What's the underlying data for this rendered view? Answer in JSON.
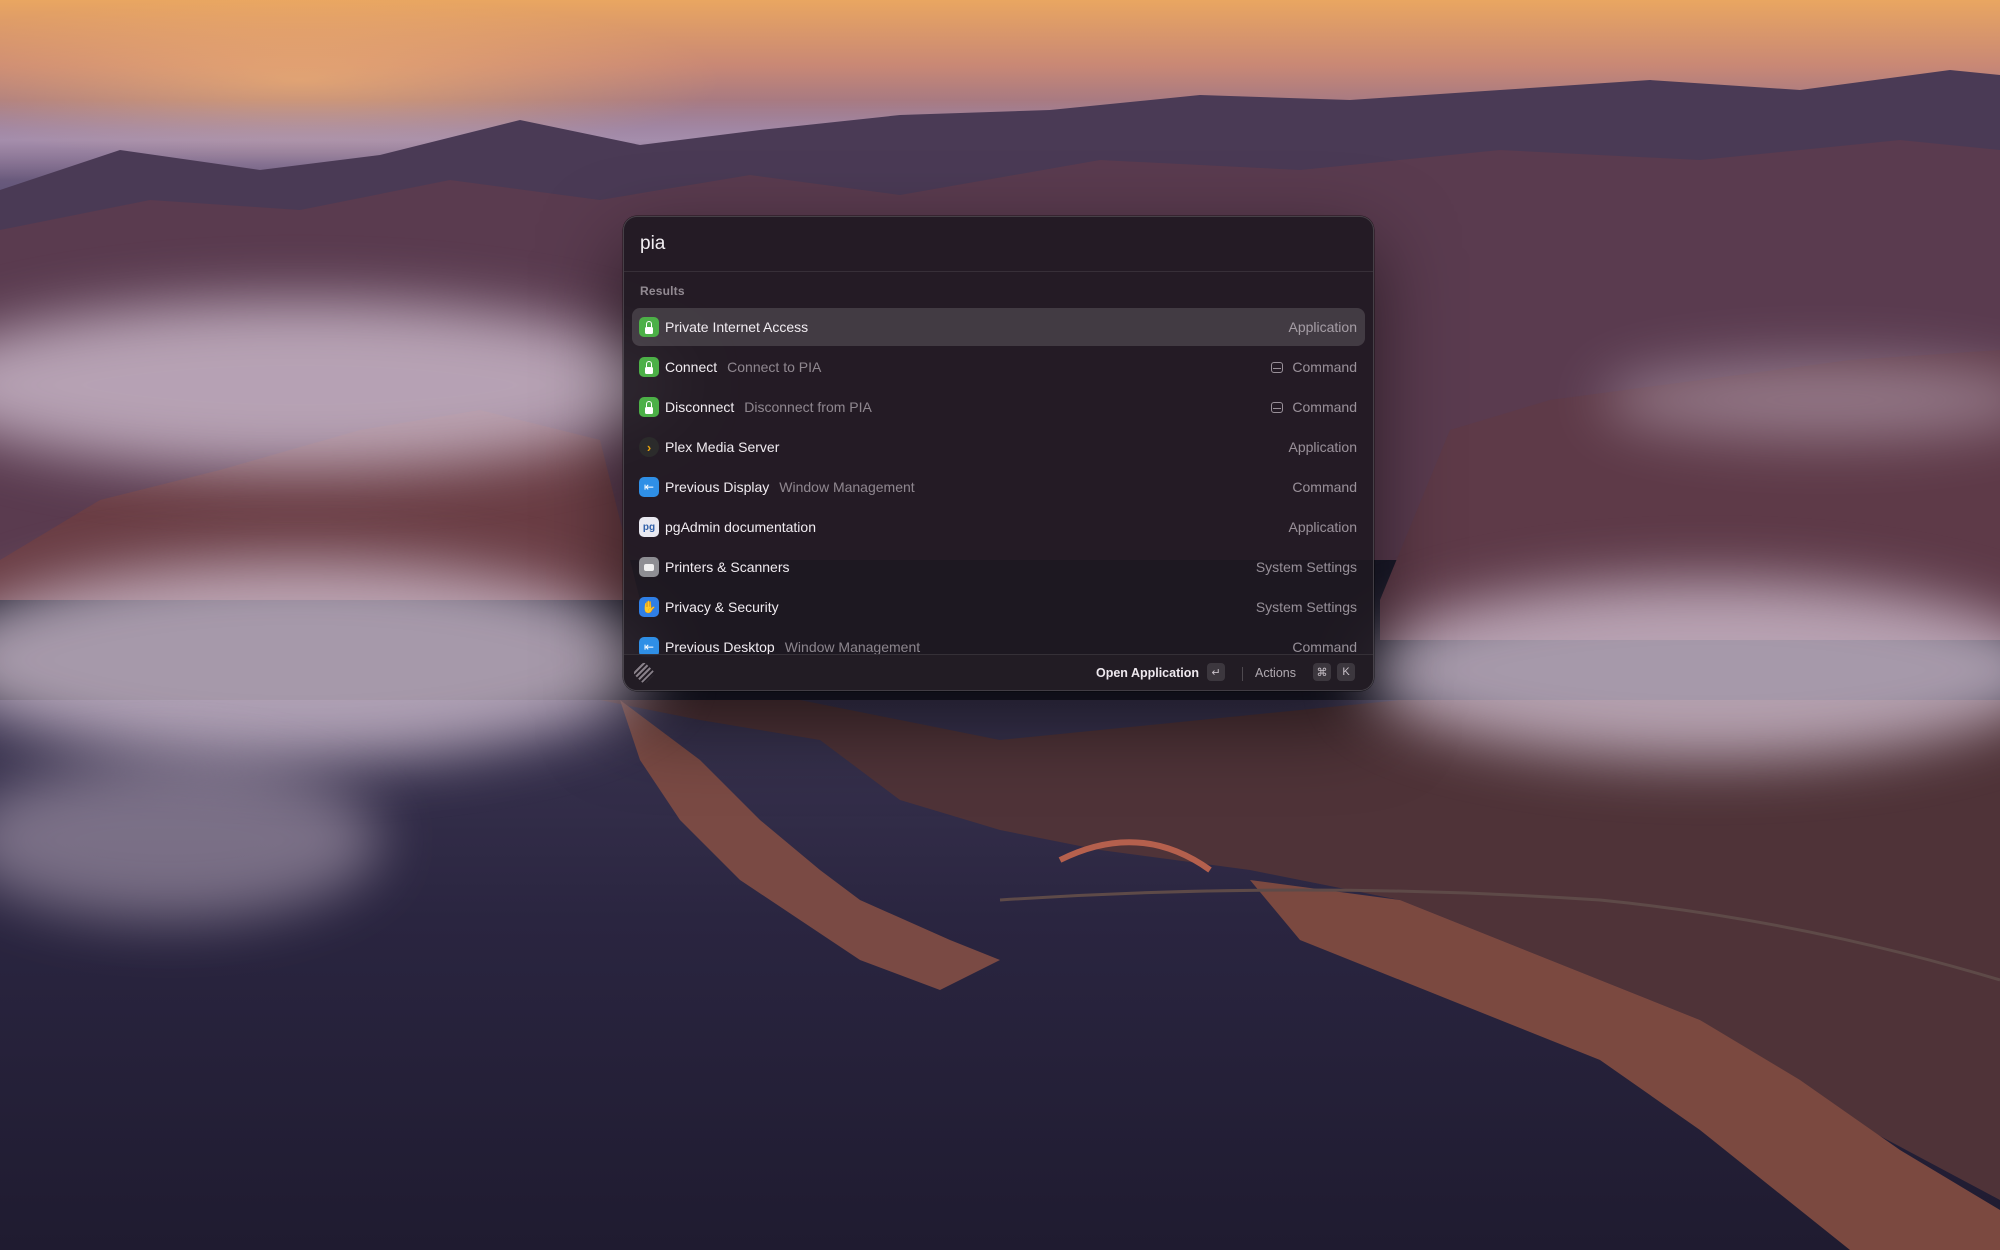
{
  "search": {
    "value": "pia"
  },
  "results": {
    "section_title": "Results",
    "items": [
      {
        "title": "Private Internet Access",
        "subtitle": "",
        "type": "Application",
        "icon": "pia-lock-icon",
        "command_glyph": false,
        "selected": true
      },
      {
        "title": "Connect",
        "subtitle": "Connect to PIA",
        "type": "Command",
        "icon": "pia-lock-icon",
        "command_glyph": true,
        "selected": false
      },
      {
        "title": "Disconnect",
        "subtitle": "Disconnect from PIA",
        "type": "Command",
        "icon": "pia-lock-icon",
        "command_glyph": true,
        "selected": false
      },
      {
        "title": "Plex Media Server",
        "subtitle": "",
        "type": "Application",
        "icon": "plex-icon",
        "command_glyph": false,
        "selected": false
      },
      {
        "title": "Previous Display",
        "subtitle": "Window Management",
        "type": "Command",
        "icon": "window-management-icon",
        "command_glyph": false,
        "selected": false
      },
      {
        "title": "pgAdmin documentation",
        "subtitle": "",
        "type": "Application",
        "icon": "pgadmin-icon",
        "command_glyph": false,
        "selected": false
      },
      {
        "title": "Printers & Scanners",
        "subtitle": "",
        "type": "System Settings",
        "icon": "printer-icon",
        "command_glyph": false,
        "selected": false
      },
      {
        "title": "Privacy & Security",
        "subtitle": "",
        "type": "System Settings",
        "icon": "privacy-hand-icon",
        "command_glyph": false,
        "selected": false
      },
      {
        "title": "Previous Desktop",
        "subtitle": "Window Management",
        "type": "Command",
        "icon": "window-management-icon",
        "command_glyph": false,
        "selected": false
      }
    ]
  },
  "footer": {
    "primary_action": "Open Application",
    "primary_key": "↵",
    "actions_label": "Actions",
    "actions_keys": [
      "⌘",
      "K"
    ]
  },
  "colors": {
    "pia_green": "#4cb047",
    "accent_blue": "#2f8fe6",
    "plex_orange": "#e5a00d"
  }
}
